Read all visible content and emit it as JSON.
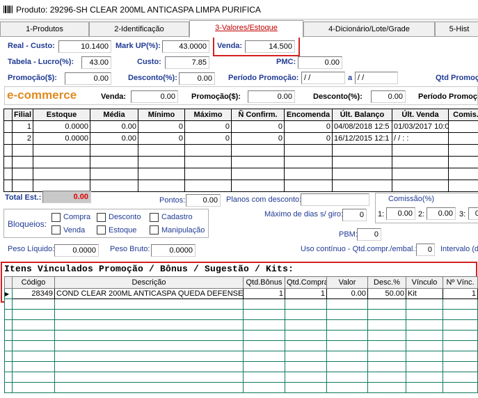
{
  "window": {
    "title": "Produto: 29296-SH CLEAR 200ML ANTICASPA LIMPA PURIFICA"
  },
  "tabs": [
    {
      "label": "1-Produtos"
    },
    {
      "label": "2-Identificação"
    },
    {
      "label": "3-Valores/Estoque"
    },
    {
      "label": "4-Dicionário/Lote/Grade"
    },
    {
      "label": "5-Hist"
    }
  ],
  "pricing": {
    "real_custo_label": "Real - Custo:",
    "real_custo": "10.1400",
    "markup_label": "Mark UP(%):",
    "markup": "43.0000",
    "venda_label": "Venda:",
    "venda": "14.500",
    "tabela_lucro_label": "Tabela - Lucro(%):",
    "tabela_lucro": "43.00",
    "custo_label": "Custo:",
    "custo": "7.85",
    "pmc_label": "PMC:",
    "pmc": "0.00",
    "promocao_label": "Promoção($):",
    "promocao": "0.00",
    "desconto_label": "Desconto(%):",
    "desconto": "0.00",
    "periodo_label": "Período Promoção:",
    "periodo_de": " / /",
    "periodo_a_label": "a",
    "periodo_ate": " / /",
    "qtd_promo_label": "Qtd Promoç"
  },
  "ecommerce": {
    "title": "e-commerce",
    "venda_label": "Venda:",
    "venda": "0.00",
    "promocao_label": "Promoção($):",
    "promocao": "0.00",
    "desconto_label": "Desconto(%):",
    "desconto": "0.00",
    "periodo_label": "Período Promoç"
  },
  "stock_table": {
    "headers": [
      "Filial",
      "Estoque",
      "Média",
      "Mínimo",
      "Máximo",
      "Ñ Confirm.",
      "Encomenda",
      "Últ. Balanço",
      "Últ. Venda",
      "Comis. C"
    ],
    "rows": [
      [
        "1",
        "0.0000",
        "0.00",
        "0",
        "0",
        "0",
        "0",
        "04/08/2018 12:5",
        "01/03/2017 10:0",
        ""
      ],
      [
        "2",
        "0.0000",
        "0.00",
        "0",
        "0",
        "0",
        "0",
        "16/12/2015 12:1",
        "/ /  : :",
        ""
      ]
    ]
  },
  "totals": {
    "total_est_label": "Total Est.:",
    "total_est": "0.00",
    "pontos_label": "Pontos:",
    "pontos": "0.00",
    "planos_label": "Planos com desconto:",
    "planos": "",
    "comissao_label": "Comissão(%)",
    "comissao_1_label": "1:",
    "comissao_1": "0.00",
    "comissao_2_label": "2:",
    "comissao_2": "0.00",
    "comissao_3_label": "3:",
    "comissao_3": "0",
    "max_dias_label": "Máximo de dias s/ giro:",
    "max_dias": "0",
    "pbm_label": "PBM:",
    "pbm": "0",
    "uso_continuo_label": "Uso contínuo - Qtd.compr./embal.:",
    "uso_continuo": "0",
    "intervalo_label": "Intervalo (d"
  },
  "bloqueios": {
    "label": "Bloqueios:",
    "options": [
      "Compra",
      "Desconto",
      "Cadastro",
      "Venda",
      "Estoque",
      "Manipulação"
    ]
  },
  "peso": {
    "liquido_label": "Peso Líquido:",
    "liquido": "0.0000",
    "bruto_label": "Peso Bruto:",
    "bruto": "0.0000"
  },
  "linked_items": {
    "title": "Itens Vinculados Promoção / Bônus / Sugestão / Kits:",
    "headers": [
      "Código",
      "Descrição",
      "Qtd.Bônus",
      "Qtd.Compra",
      "Valor",
      "Desc.%",
      "Vínculo",
      "Nº Vínc."
    ],
    "rows": [
      [
        "28349",
        "COND CLEAR 200ML ANTICASPA QUEDA DEFENSE",
        "1",
        "1",
        "0.00",
        "50.00",
        "Kit",
        "1"
      ]
    ]
  },
  "colors": {
    "highlight_red": "#d42020",
    "label_blue": "#1f3a93",
    "ecommerce_orange": "#e08a1e",
    "total_bg": "#c8c8c8"
  }
}
